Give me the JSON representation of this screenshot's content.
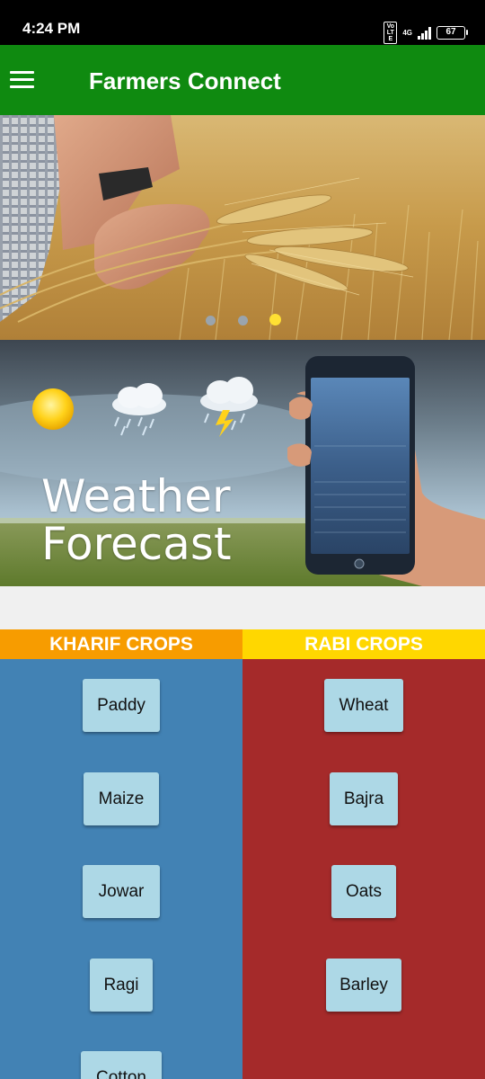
{
  "status_bar": {
    "time": "4:24 PM",
    "volte": "Vo LTE",
    "network": "4G",
    "battery": "67"
  },
  "app_bar": {
    "title": "Farmers Connect",
    "menu_icon": "hamburger-menu-icon"
  },
  "carousel": {
    "slide_count": 3,
    "active_index": 2
  },
  "weather_banner": {
    "line1": "Weather",
    "line2": "Forecast"
  },
  "crops": {
    "kharif": {
      "header": "KHARIF CROPS",
      "items": [
        "Paddy",
        "Maize",
        "Jowar",
        "Ragi",
        "Cotton"
      ]
    },
    "rabi": {
      "header": "RABI CROPS",
      "items": [
        "Wheat",
        "Bajra",
        "Oats",
        "Barley"
      ]
    }
  },
  "colors": {
    "app_bar": "#0f8a10",
    "kharif_header": "#f79c00",
    "rabi_header": "#ffd700",
    "kharif_bg": "#4282b4",
    "rabi_bg": "#a52a2a",
    "crop_button": "#add8e6"
  }
}
